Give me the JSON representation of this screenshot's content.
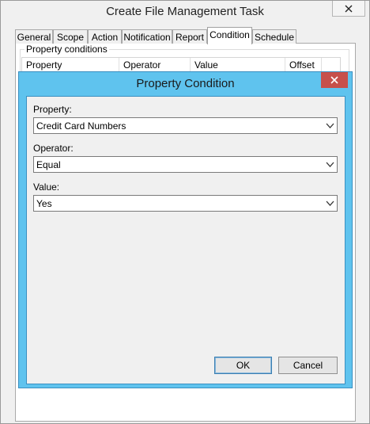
{
  "outer_window": {
    "title": "Create File Management Task",
    "tabs": [
      {
        "label": "General",
        "active": false
      },
      {
        "label": "Scope",
        "active": false
      },
      {
        "label": "Action",
        "active": false
      },
      {
        "label": "Notification",
        "active": false
      },
      {
        "label": "Report",
        "active": false
      },
      {
        "label": "Condition",
        "active": true
      },
      {
        "label": "Schedule",
        "active": false
      }
    ],
    "group_label": "Property conditions",
    "columns": [
      "Property",
      "Operator",
      "Value",
      "Offset"
    ]
  },
  "dialog": {
    "title": "Property Condition",
    "fields": [
      {
        "label": "Property:",
        "value": "Credit Card Numbers"
      },
      {
        "label": "Operator:",
        "value": "Equal"
      },
      {
        "label": "Value:",
        "value": "Yes"
      }
    ],
    "ok_label": "OK",
    "cancel_label": "Cancel"
  },
  "colors": {
    "dialog_frame": "#5fc3ee",
    "close_button": "#c7504a"
  }
}
